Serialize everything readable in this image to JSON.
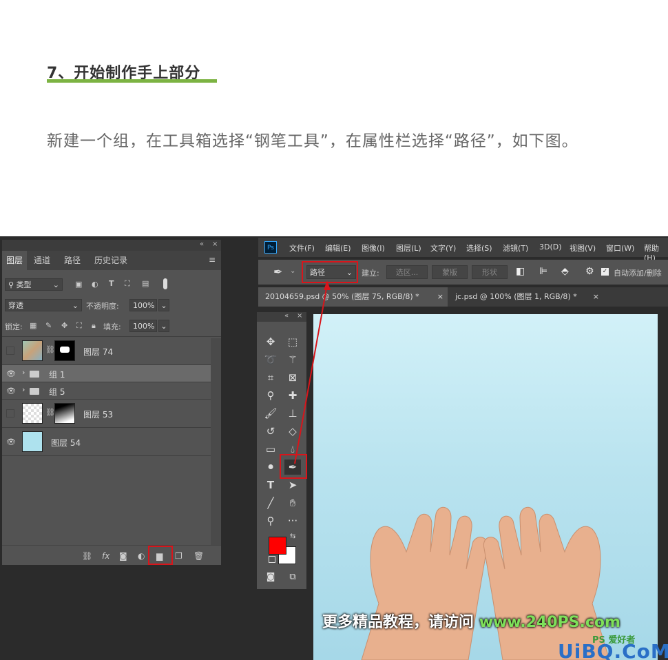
{
  "article": {
    "heading": "7、开始制作手上部分",
    "paragraph": "新建一个组，在工具箱选择“钢笔工具”，在属性栏选择“路径”，如下图。"
  },
  "layers_panel": {
    "tabs": [
      "图层",
      "通道",
      "路径",
      "历史记录"
    ],
    "filter_label": "类型",
    "blend_mode": "穿透",
    "opacity_label": "不透明度:",
    "opacity_value": "100%",
    "lock_label": "锁定:",
    "fill_label": "填充:",
    "fill_value": "100%",
    "layers": [
      {
        "name": "图层 74",
        "visible": false,
        "type": "masked"
      },
      {
        "name": "组 1",
        "visible": true,
        "type": "group",
        "selected": true
      },
      {
        "name": "组 5",
        "visible": true,
        "type": "group"
      },
      {
        "name": "图层 53",
        "visible": false,
        "type": "masked"
      },
      {
        "name": "图层 54",
        "visible": true,
        "type": "plain"
      }
    ],
    "bottom_icons": [
      "link-icon",
      "fx-icon",
      "mask-icon",
      "adjustment-icon",
      "new-group-icon",
      "new-layer-icon",
      "trash-icon"
    ],
    "fx_label": "fx"
  },
  "photoshop": {
    "logo": "Ps",
    "menus": [
      "文件(F)",
      "编辑(E)",
      "图像(I)",
      "图层(L)",
      "文字(Y)",
      "选择(S)",
      "滤镜(T)",
      "3D(D)",
      "视图(V)",
      "窗口(W)",
      "帮助(H)"
    ],
    "options": {
      "mode": "路径",
      "make_label": "建立:",
      "selection_btn": "选区...",
      "mask_btn": "蒙版",
      "shape_btn": "形状",
      "auto_add": "自动添加/删除"
    },
    "doc_tabs": [
      "20104659.psd @ 50% (图层 75, RGB/8) *",
      "jc.psd @ 100% (图层 1, RGB/8) *"
    ],
    "foreground_color": "#ff0000",
    "background_color": "#ffffff"
  },
  "watermark": {
    "text": "更多精品教程，请访问",
    "url": "www.240PS.com"
  },
  "site_logo": "UiBQ.CoM",
  "site_logo_ps": "PS 爱好者",
  "colors": {
    "accent_green": "#7cb342",
    "highlight_red": "#d8151b"
  }
}
